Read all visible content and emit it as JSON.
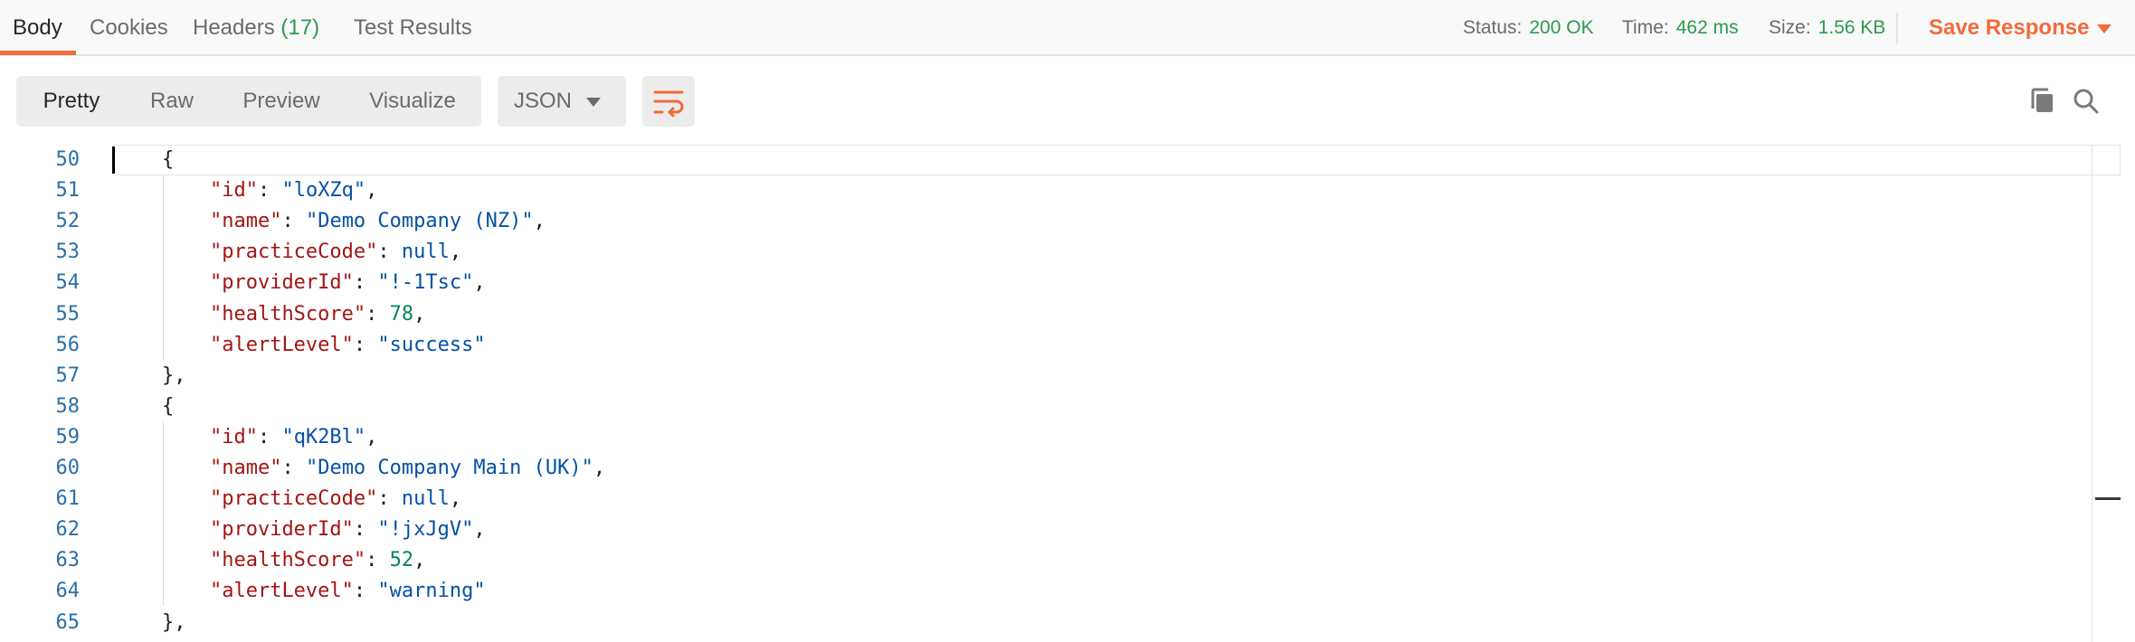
{
  "tabs": [
    {
      "label": "Body"
    },
    {
      "label": "Cookies"
    },
    {
      "label": "Headers",
      "count": "(17)"
    },
    {
      "label": "Test Results"
    }
  ],
  "status": {
    "status_label": "Status:",
    "status_value": "200 OK",
    "time_label": "Time:",
    "time_value": "462 ms",
    "size_label": "Size:",
    "size_value": "1.56 KB"
  },
  "save_response": "Save Response",
  "view_modes": [
    "Pretty",
    "Raw",
    "Preview",
    "Visualize"
  ],
  "format": "JSON",
  "icons": {
    "wrap": "wrap-lines-icon",
    "copy": "copy-icon",
    "search": "search-icon"
  },
  "colors": {
    "accent": "#f26b3a",
    "status_ok": "#2c9a4b",
    "json_key": "#a31515",
    "json_string": "#0451a5",
    "json_number": "#098658"
  },
  "code": [
    {
      "num": "50",
      "indent": "    ",
      "tokens": [
        {
          "t": "{",
          "c": "p"
        }
      ]
    },
    {
      "num": "51",
      "indent": "        ",
      "tokens": [
        {
          "t": "\"id\"",
          "c": "k"
        },
        {
          "t": ": ",
          "c": "p"
        },
        {
          "t": "\"loXZq\"",
          "c": "s"
        },
        {
          "t": ",",
          "c": "p"
        }
      ]
    },
    {
      "num": "52",
      "indent": "        ",
      "tokens": [
        {
          "t": "\"name\"",
          "c": "k"
        },
        {
          "t": ": ",
          "c": "p"
        },
        {
          "t": "\"Demo Company (NZ)\"",
          "c": "s"
        },
        {
          "t": ",",
          "c": "p"
        }
      ]
    },
    {
      "num": "53",
      "indent": "        ",
      "tokens": [
        {
          "t": "\"practiceCode\"",
          "c": "k"
        },
        {
          "t": ": ",
          "c": "p"
        },
        {
          "t": "null",
          "c": "l"
        },
        {
          "t": ",",
          "c": "p"
        }
      ]
    },
    {
      "num": "54",
      "indent": "        ",
      "tokens": [
        {
          "t": "\"providerId\"",
          "c": "k"
        },
        {
          "t": ": ",
          "c": "p"
        },
        {
          "t": "\"!-1Tsc\"",
          "c": "s"
        },
        {
          "t": ",",
          "c": "p"
        }
      ]
    },
    {
      "num": "55",
      "indent": "        ",
      "tokens": [
        {
          "t": "\"healthScore\"",
          "c": "k"
        },
        {
          "t": ": ",
          "c": "p"
        },
        {
          "t": "78",
          "c": "n"
        },
        {
          "t": ",",
          "c": "p"
        }
      ]
    },
    {
      "num": "56",
      "indent": "        ",
      "tokens": [
        {
          "t": "\"alertLevel\"",
          "c": "k"
        },
        {
          "t": ": ",
          "c": "p"
        },
        {
          "t": "\"success\"",
          "c": "s"
        }
      ]
    },
    {
      "num": "57",
      "indent": "    ",
      "tokens": [
        {
          "t": "},",
          "c": "p"
        }
      ]
    },
    {
      "num": "58",
      "indent": "    ",
      "tokens": [
        {
          "t": "{",
          "c": "p"
        }
      ]
    },
    {
      "num": "59",
      "indent": "        ",
      "tokens": [
        {
          "t": "\"id\"",
          "c": "k"
        },
        {
          "t": ": ",
          "c": "p"
        },
        {
          "t": "\"qK2Bl\"",
          "c": "s"
        },
        {
          "t": ",",
          "c": "p"
        }
      ]
    },
    {
      "num": "60",
      "indent": "        ",
      "tokens": [
        {
          "t": "\"name\"",
          "c": "k"
        },
        {
          "t": ": ",
          "c": "p"
        },
        {
          "t": "\"Demo Company Main (UK)\"",
          "c": "s"
        },
        {
          "t": ",",
          "c": "p"
        }
      ]
    },
    {
      "num": "61",
      "indent": "        ",
      "tokens": [
        {
          "t": "\"practiceCode\"",
          "c": "k"
        },
        {
          "t": ": ",
          "c": "p"
        },
        {
          "t": "null",
          "c": "l"
        },
        {
          "t": ",",
          "c": "p"
        }
      ]
    },
    {
      "num": "62",
      "indent": "        ",
      "tokens": [
        {
          "t": "\"providerId\"",
          "c": "k"
        },
        {
          "t": ": ",
          "c": "p"
        },
        {
          "t": "\"!jxJgV\"",
          "c": "s"
        },
        {
          "t": ",",
          "c": "p"
        }
      ]
    },
    {
      "num": "63",
      "indent": "        ",
      "tokens": [
        {
          "t": "\"healthScore\"",
          "c": "k"
        },
        {
          "t": ": ",
          "c": "p"
        },
        {
          "t": "52",
          "c": "n"
        },
        {
          "t": ",",
          "c": "p"
        }
      ]
    },
    {
      "num": "64",
      "indent": "        ",
      "tokens": [
        {
          "t": "\"alertLevel\"",
          "c": "k"
        },
        {
          "t": ": ",
          "c": "p"
        },
        {
          "t": "\"warning\"",
          "c": "s"
        }
      ]
    },
    {
      "num": "65",
      "indent": "    ",
      "tokens": [
        {
          "t": "},",
          "c": "p"
        }
      ]
    }
  ]
}
